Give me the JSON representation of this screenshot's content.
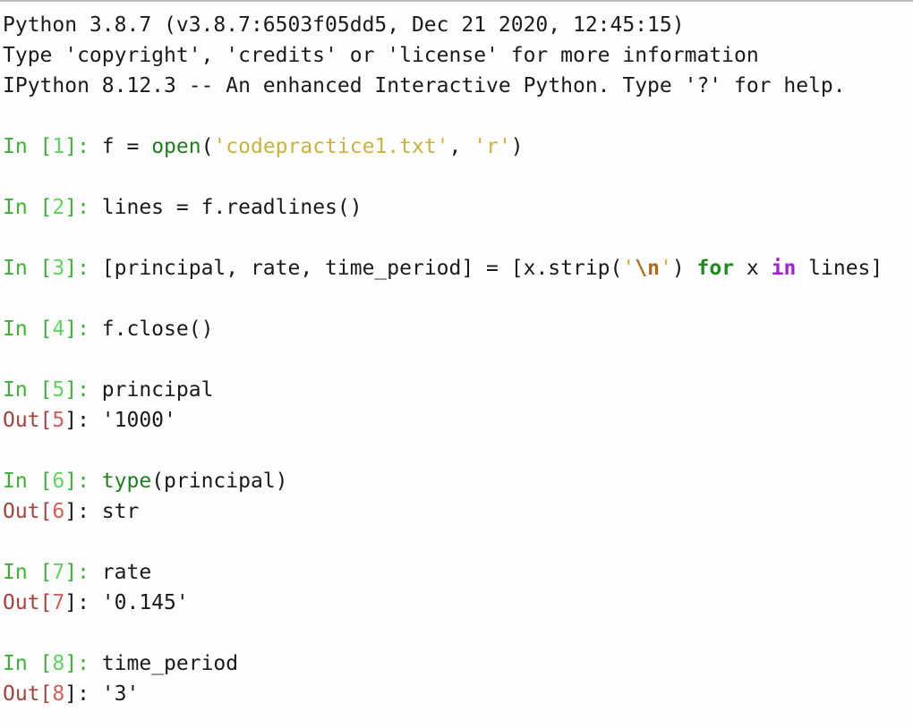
{
  "banner": {
    "line1": "Python 3.8.7 (v3.8.7:6503f05dd5, Dec 21 2020, 12:45:15)",
    "line2": "Type 'copyright', 'credits' or 'license' for more information",
    "line3": "IPython 8.12.3 -- An enhanced Interactive Python. Type '?' for help."
  },
  "prompt": {
    "in_label": "In [",
    "out_label": "Out[",
    "close": "]: "
  },
  "cells": [
    {
      "num": "1",
      "code": {
        "a": "f = ",
        "func": "open",
        "b": "(",
        "s1": "'codepractice1.txt'",
        "c": ", ",
        "s2": "'r'",
        "d": ")"
      }
    },
    {
      "num": "2",
      "code": "lines = f.readlines()"
    },
    {
      "num": "3",
      "code": {
        "a": "[principal, rate, time_period] = [x.strip(",
        "q1": "'",
        "esc": "\\n",
        "q2": "'",
        "b": ") ",
        "kw_for": "for",
        "c": " x ",
        "kw_in": "in",
        "d": " lines]"
      }
    },
    {
      "num": "4",
      "code": "f.close()"
    },
    {
      "num": "5",
      "code": "principal",
      "out": "'1000'"
    },
    {
      "num": "6",
      "code": {
        "func": "type",
        "rest": "(principal)"
      },
      "out": "str"
    },
    {
      "num": "7",
      "code": "rate",
      "out": "'0.145'"
    },
    {
      "num": "8",
      "code": "time_period",
      "out": "'3'"
    }
  ],
  "colors": {
    "prompt_in": "#3fae3a",
    "prompt_out": "#a8423d",
    "string": "#c8b43a",
    "keyword": "#1f8b1f",
    "keyword_in": "#a51fd8"
  }
}
